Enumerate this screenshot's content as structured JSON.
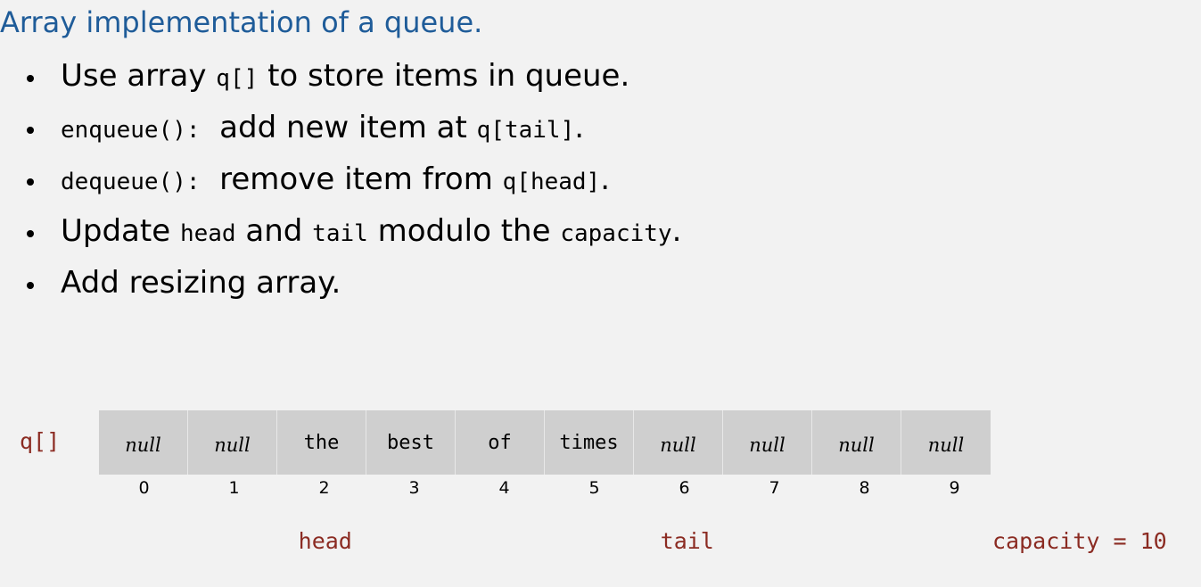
{
  "title": "Array implementation of a queue.",
  "bullets": [
    {
      "parts": [
        {
          "t": "Use array ",
          "code": false
        },
        {
          "t": "q[]",
          "code": true
        },
        {
          "t": " to store items in queue.",
          "code": false
        }
      ]
    },
    {
      "parts": [
        {
          "t": "enqueue():",
          "code": true
        },
        {
          "t": "  add new item at ",
          "code": false
        },
        {
          "t": "q[tail]",
          "code": true
        },
        {
          "t": ".",
          "code": false
        }
      ]
    },
    {
      "parts": [
        {
          "t": "dequeue():",
          "code": true
        },
        {
          "t": "  remove item from ",
          "code": false
        },
        {
          "t": "q[head]",
          "code": true
        },
        {
          "t": ".",
          "code": false
        }
      ]
    },
    {
      "parts": [
        {
          "t": "Update ",
          "code": false
        },
        {
          "t": "head",
          "code": true
        },
        {
          "t": " and ",
          "code": false
        },
        {
          "t": "tail",
          "code": true
        },
        {
          "t": " modulo the ",
          "code": false
        },
        {
          "t": "capacity",
          "code": true
        },
        {
          "t": ".",
          "code": false
        }
      ]
    },
    {
      "parts": [
        {
          "t": "Add resizing array.",
          "code": false
        }
      ]
    }
  ],
  "diagram": {
    "array_label": "q[]",
    "cells": [
      {
        "value": "null",
        "is_null": true
      },
      {
        "value": "null",
        "is_null": true
      },
      {
        "value": "the",
        "is_null": false
      },
      {
        "value": "best",
        "is_null": false
      },
      {
        "value": "of",
        "is_null": false
      },
      {
        "value": "times",
        "is_null": false
      },
      {
        "value": "null",
        "is_null": true
      },
      {
        "value": "null",
        "is_null": true
      },
      {
        "value": "null",
        "is_null": true
      },
      {
        "value": "null",
        "is_null": true
      }
    ],
    "indices": [
      "0",
      "1",
      "2",
      "3",
      "4",
      "5",
      "6",
      "7",
      "8",
      "9"
    ],
    "head_label": "head",
    "head_index": 2,
    "tail_label": "tail",
    "tail_index": 6,
    "capacity_label": "capacity = 10"
  }
}
